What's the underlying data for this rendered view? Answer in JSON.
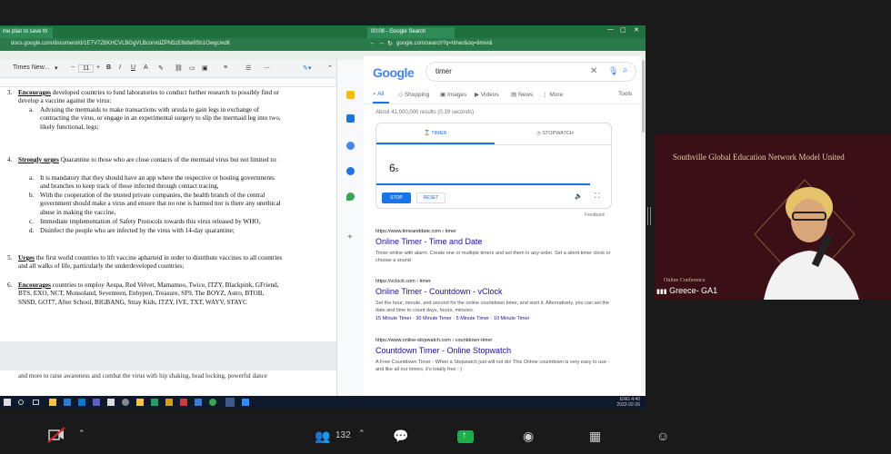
{
  "docs": {
    "tab_title": "me plan to save th",
    "url": "docs.google.com/document/d/1ETV7Z6KHCVLBGgVLBcorvtdZPN5zEtbdw9Sb1Owgc/edit",
    "font_name": "Times New...",
    "font_size": "11",
    "para3_label": "3.",
    "para3_bold": "Encourages",
    "para3_text": "developed countries to fund laboratories to conduct further research to possibly find or develop a vaccine against the virus:",
    "para3_a_label": "a.",
    "para3_a_text": "Advising the mermaids to make transactions with ursula to gain legs in exchange of contracting the virus, or engage in an experimental surgery to slip the mermaid leg into two, likely functional, legs;",
    "para4_label": "4.",
    "para4_bold": "Strongly urges",
    "para4_text": "Quarantine to those who are close contacts of the mermaid virus but not limited to:",
    "para4_a_label": "a.",
    "para4_a_text": "It is mandatory that they should have an app where the respective or hosting governments and branches to keep track of those infected through contact tracing,",
    "para4_b_label": "b.",
    "para4_b_text": "With the cooperation of the trusted private companies, the health branch of the central government should make a virus and ensure that no one is harmed nor is there any unethical abuse in making the vaccine,",
    "para4_c_label": "c.",
    "para4_c_text": "Immediate implementation of Safety Protocols towards this virus released by WHO,",
    "para4_d_label": "d.",
    "para4_d_text": "Disinfect the people who are infected by the virus with 14-day quarantine;",
    "para5_label": "5.",
    "para5_bold": "Urges",
    "para5_text": "the first world countries to lift vaccine apharteid in order to distribute vaccines to all countries and all walks of life, particularly the underdeveloped countries;",
    "para6_label": "6.",
    "para6_bold": "Encourages",
    "para6_text": "countries to employ Aespa, Red Velvet, Mamamoo, Twice, ITZY, Blackpink, GFriend, BTS, EXO, NCT, Monsoland, Seventeen, Enhypen, Treasure, SF9, The BOYZ, Astro, BTOB, SNSD, GOT7, After School, BIGBANG, Stray Kids, ITZY, IVE, TXT, WAYV, STAYC",
    "page2_text": "and more to raise awareness and combat the virus with hip shaking, head locking, powerful dance"
  },
  "google": {
    "tab_title": "00:06 - Google Search",
    "url": "google.com/search?q=timer&oq=timer&",
    "logo": "Google",
    "query": "timer",
    "tabs": [
      "All",
      "Shopping",
      "Images",
      "Videos",
      "News",
      "More"
    ],
    "tools": "Tools",
    "stats": "About 41,000,000 results (0.39 seconds)",
    "timer": {
      "tab_timer": "TIMER",
      "tab_stopwatch": "STOPWATCH",
      "value": "6",
      "unit": "s",
      "stop": "STOP",
      "reset": "RESET",
      "feedback": "Feedback"
    },
    "results": [
      {
        "url": "https://www.timeanddate.com › timer",
        "title": "Online Timer - Time and Date",
        "snippet": "Timer online with alarm. Create one or multiple timers and set them in any order. Set a silent timer clock or choose a sound"
      },
      {
        "url": "https://vclock.com › timer",
        "title": "Online Timer - Countdown - vClock",
        "snippet": "Set the hour, minute, and second for the online countdown timer, and start it. Alternatively, you can set the date and time to count days, hours, minutes.",
        "sitelinks": "15 Minute Timer · 30 Minute Timer · 5 Minute Timer · 10 Minute Timer"
      },
      {
        "url": "https://www.online-stopwatch.com › countdown-timer",
        "title": "Countdown Timer - Online Stopwatch",
        "snippet": "A Free Countdown Timer - When a Stopwatch just will not do! This Online countdown is very easy to use - and like all our timers, it's totally free :-)"
      }
    ]
  },
  "video": {
    "banner": "Southville Global Education Network Model United",
    "sub": "Online Conference",
    "participant": "Greece- GA1"
  },
  "taskbar": {
    "lang": "ENG",
    "time": "4:40",
    "date": "2022-02-26"
  },
  "zoom": {
    "participants_count": "132"
  },
  "colors": {
    "accent_green": "#1f6f3f",
    "link_blue": "#1a0dab",
    "share_green": "#1bae4b",
    "video_bg": "#3a0f16"
  }
}
